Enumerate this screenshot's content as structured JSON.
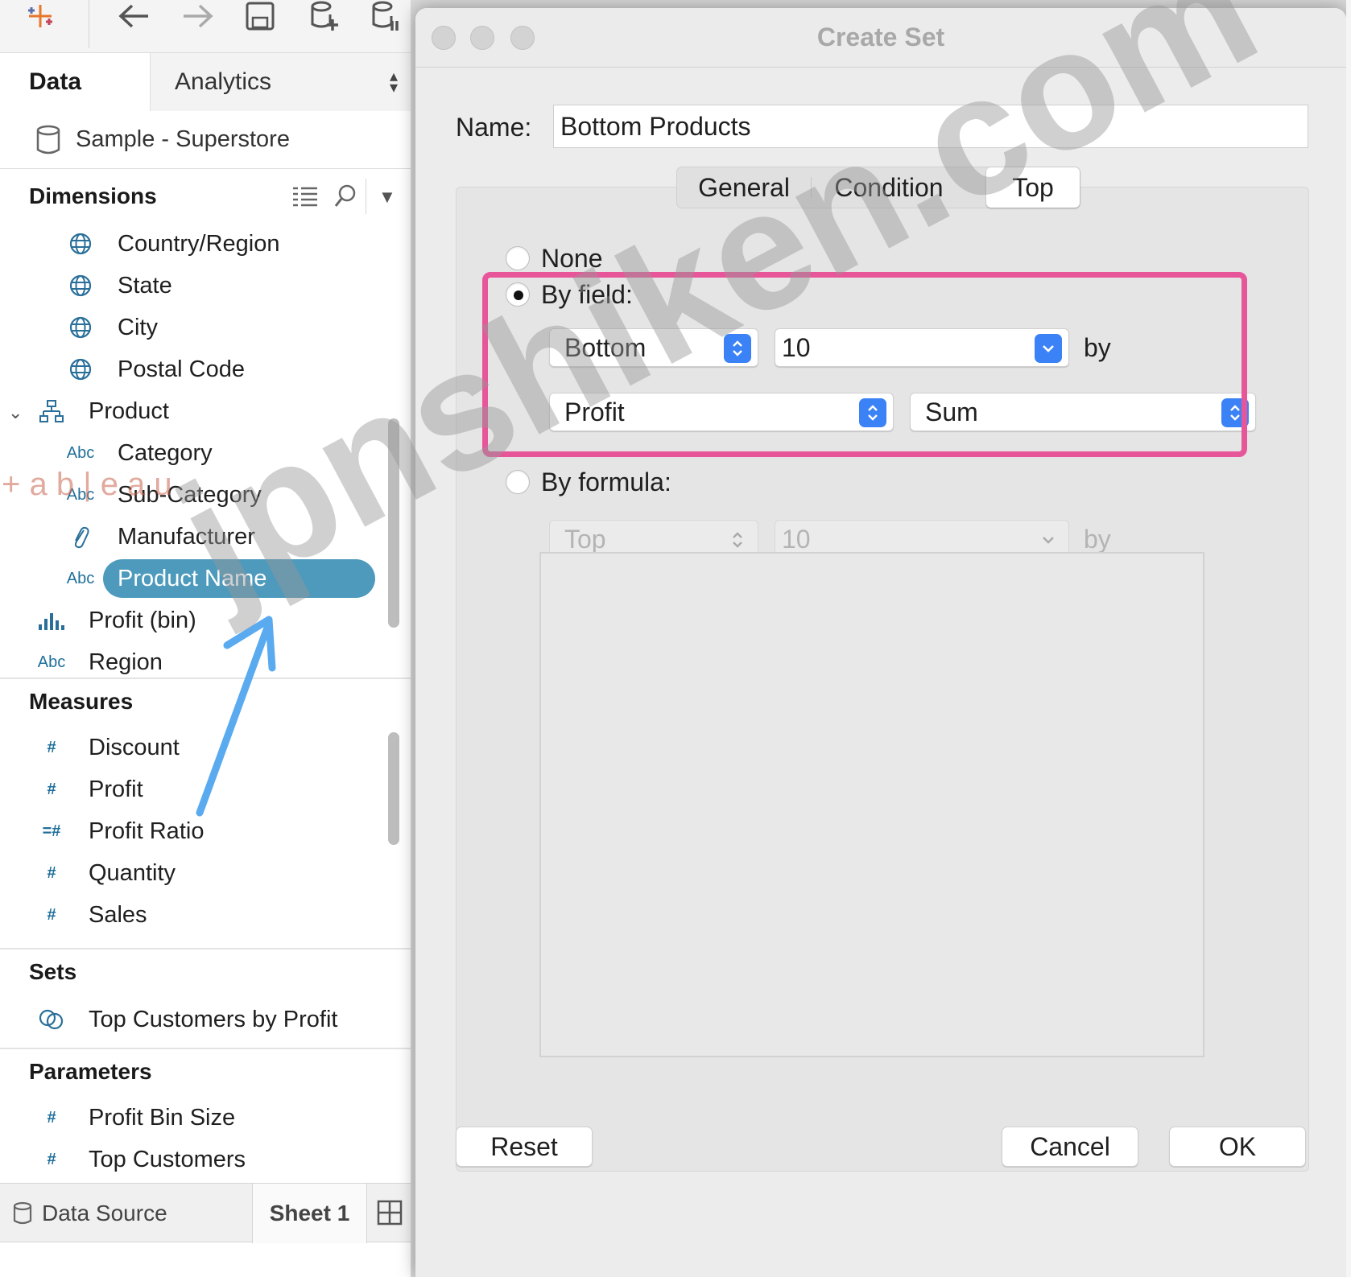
{
  "dialog": {
    "title": "Create Set",
    "name_label": "Name:",
    "name_value": "Bottom Products",
    "tabs": [
      {
        "label": "General",
        "selected": false
      },
      {
        "label": "Condition",
        "selected": false
      },
      {
        "label": "Top",
        "selected": true
      }
    ],
    "options": {
      "none_label": "None",
      "by_field_label": "By field:",
      "by_formula_label": "By formula:",
      "selected": "by_field"
    },
    "by_field": {
      "direction": "Bottom",
      "count": "10",
      "by": "by",
      "field": "Profit",
      "aggregation": "Sum"
    },
    "by_formula": {
      "direction": "Top",
      "count": "10",
      "by": "by"
    },
    "buttons": {
      "reset": "Reset",
      "cancel": "Cancel",
      "ok": "OK"
    },
    "highlight_color": "#e8569a",
    "accent_color": "#3b82f6"
  },
  "left_pane": {
    "tabs": {
      "data": "Data",
      "analytics": "Analytics"
    },
    "datasource": "Sample - Superstore",
    "sections": {
      "dimensions": "Dimensions",
      "measures": "Measures",
      "sets": "Sets",
      "parameters": "Parameters"
    },
    "dimensions": [
      {
        "label": "Country/Region",
        "icon": "globe-icon"
      },
      {
        "label": "State",
        "icon": "globe-icon"
      },
      {
        "label": "City",
        "icon": "globe-icon"
      },
      {
        "label": "Postal Code",
        "icon": "globe-icon"
      },
      {
        "label": "Product",
        "icon": "hierarchy-icon"
      },
      {
        "label": "Category",
        "icon": "Abc"
      },
      {
        "label": "Sub-Category",
        "icon": "Abc"
      },
      {
        "label": "Manufacturer",
        "icon": "paperclip-icon"
      },
      {
        "label": "Product Name",
        "icon": "Abc"
      },
      {
        "label": "Profit (bin)",
        "icon": "bin-chart-icon"
      },
      {
        "label": "Region",
        "icon": "Abc"
      }
    ],
    "measures": [
      "Discount",
      "Profit",
      "Profit Ratio",
      "Quantity",
      "Sales"
    ],
    "sets": [
      "Top Customers by Profit"
    ],
    "parameters": [
      "Profit Bin Size",
      "Top Customers"
    ],
    "abc_label": "Abc",
    "selected_field_color": "#4d9abd"
  },
  "bottom_tabs": {
    "data_source": "Data Source",
    "sheet1": "Sheet 1"
  },
  "overlay": {
    "watermark": "jpnshiken.com",
    "logo_ghost": "+ a b | e a u"
  }
}
